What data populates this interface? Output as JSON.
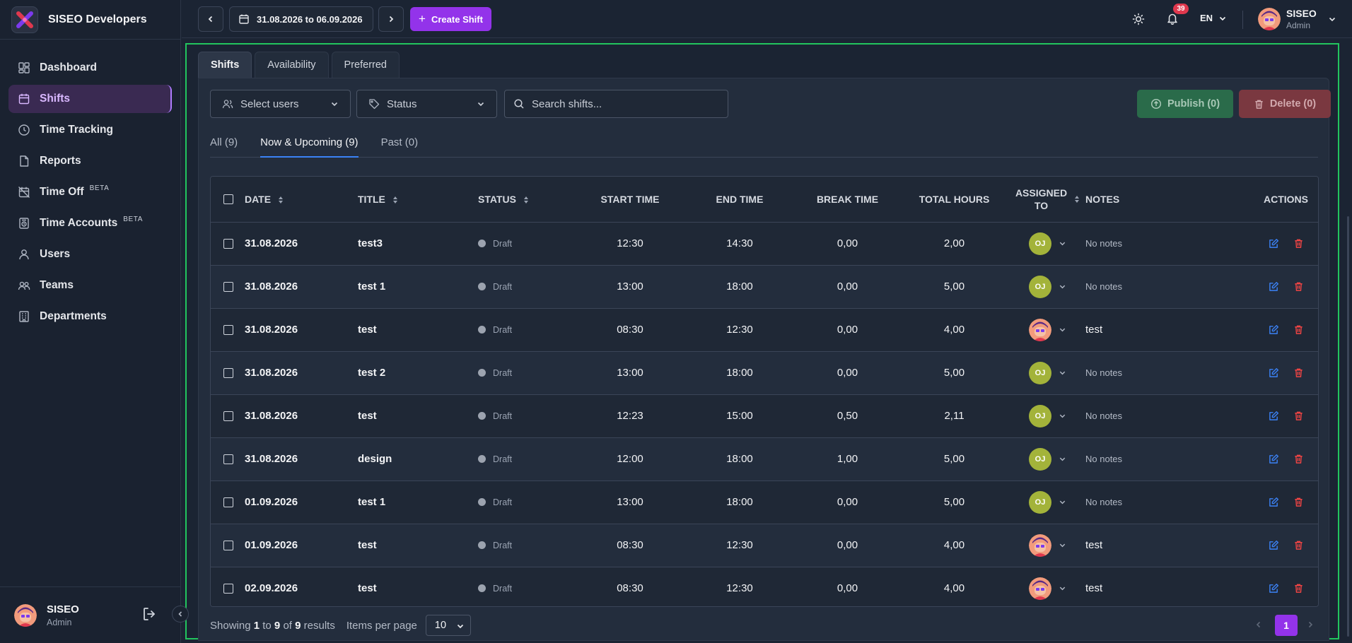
{
  "app": {
    "name": "SISEO Developers"
  },
  "sidebar": {
    "items": [
      {
        "label": "Dashboard",
        "icon": "dashboard-icon",
        "beta": ""
      },
      {
        "label": "Shifts",
        "icon": "calendar-icon",
        "beta": "",
        "active": true
      },
      {
        "label": "Time Tracking",
        "icon": "clock-icon",
        "beta": ""
      },
      {
        "label": "Reports",
        "icon": "report-icon",
        "beta": ""
      },
      {
        "label": "Time Off",
        "icon": "time-off-icon",
        "beta": "BETA"
      },
      {
        "label": "Time Accounts",
        "icon": "time-account-icon",
        "beta": "BETA"
      },
      {
        "label": "Users",
        "icon": "user-icon",
        "beta": ""
      },
      {
        "label": "Teams",
        "icon": "team-icon",
        "beta": ""
      },
      {
        "label": "Departments",
        "icon": "building-icon",
        "beta": ""
      }
    ],
    "user": {
      "name": "SISEO",
      "role": "Admin"
    }
  },
  "topbar": {
    "date_range": "31.08.2026 to 06.09.2026",
    "create_label": "Create Shift",
    "notification_count": "39",
    "language": "EN",
    "user": {
      "name": "SISEO",
      "role": "Admin"
    }
  },
  "tabs": [
    "Shifts",
    "Availability",
    "Preferred"
  ],
  "filters": {
    "users_label": "Select users",
    "status_label": "Status",
    "search_placeholder": "Search shifts..."
  },
  "actions": {
    "publish_label": "Publish (0)",
    "delete_label": "Delete (0)"
  },
  "subtabs": [
    "All (9)",
    "Now & Upcoming (9)",
    "Past (0)"
  ],
  "table": {
    "headers": {
      "date": "DATE",
      "title": "TITLE",
      "status": "STATUS",
      "start": "START TIME",
      "end": "END TIME",
      "break": "BREAK TIME",
      "total": "TOTAL HOURS",
      "assigned_1": "ASSIGNED",
      "assigned_2": "TO",
      "notes": "NOTES",
      "actions": "ACTIONS"
    },
    "rows": [
      {
        "date": "31.08.2026",
        "title": "test3",
        "status": "Draft",
        "start": "12:30",
        "end": "14:30",
        "break": "0,00",
        "total": "2,00",
        "assignee": "OJ",
        "notes": "No notes"
      },
      {
        "date": "31.08.2026",
        "title": "test 1",
        "status": "Draft",
        "start": "13:00",
        "end": "18:00",
        "break": "0,00",
        "total": "5,00",
        "assignee": "OJ",
        "notes": "No notes"
      },
      {
        "date": "31.08.2026",
        "title": "test",
        "status": "Draft",
        "start": "08:30",
        "end": "12:30",
        "break": "0,00",
        "total": "4,00",
        "assignee": "",
        "notes": "test"
      },
      {
        "date": "31.08.2026",
        "title": "test 2",
        "status": "Draft",
        "start": "13:00",
        "end": "18:00",
        "break": "0,00",
        "total": "5,00",
        "assignee": "OJ",
        "notes": "No notes"
      },
      {
        "date": "31.08.2026",
        "title": "test",
        "status": "Draft",
        "start": "12:23",
        "end": "15:00",
        "break": "0,50",
        "total": "2,11",
        "assignee": "OJ",
        "notes": "No notes"
      },
      {
        "date": "31.08.2026",
        "title": "design",
        "status": "Draft",
        "start": "12:00",
        "end": "18:00",
        "break": "1,00",
        "total": "5,00",
        "assignee": "OJ",
        "notes": "No notes"
      },
      {
        "date": "01.09.2026",
        "title": "test 1",
        "status": "Draft",
        "start": "13:00",
        "end": "18:00",
        "break": "0,00",
        "total": "5,00",
        "assignee": "OJ",
        "notes": "No notes"
      },
      {
        "date": "01.09.2026",
        "title": "test",
        "status": "Draft",
        "start": "08:30",
        "end": "12:30",
        "break": "0,00",
        "total": "4,00",
        "assignee": "",
        "notes": "test"
      },
      {
        "date": "02.09.2026",
        "title": "test",
        "status": "Draft",
        "start": "08:30",
        "end": "12:30",
        "break": "0,00",
        "total": "4,00",
        "assignee": "",
        "notes": "test"
      }
    ]
  },
  "pagination": {
    "showing": "Showing",
    "from": "1",
    "to_word": "to",
    "to": "9",
    "of_word": "of",
    "total": "9",
    "results": "results",
    "items_per_page_label": "Items per page",
    "items_per_page": "10",
    "current_page": "1"
  },
  "colors": {
    "accent": "#9333ea",
    "publish": "#2a6b4a",
    "delete": "#7a3840",
    "highlight": "#22c55e",
    "assignee": "#a3b33a"
  }
}
